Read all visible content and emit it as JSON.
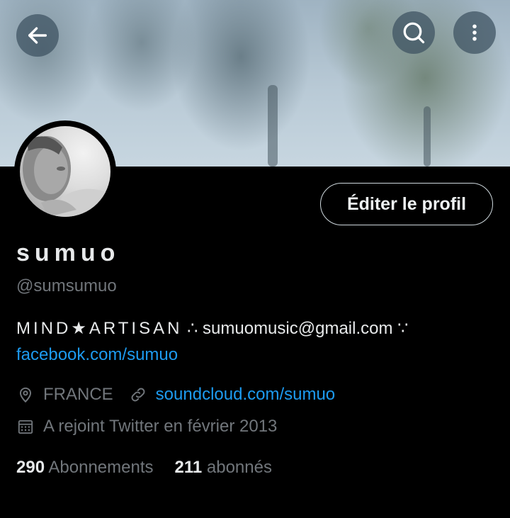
{
  "profile": {
    "display_name": "sumuo",
    "handle": "@sumsumuo",
    "bio_line1_caps": "MIND★ARTISAN",
    "bio_line1_rest": " ∴ sumuomusic@gmail.com ∵",
    "bio_link": "facebook.com/sumuo",
    "location": "FRANCE",
    "website": "soundcloud.com/sumuo",
    "joined": "A rejoint Twitter en février 2013",
    "following_count": "290",
    "following_label": "Abonnements",
    "followers_count": "211",
    "followers_label": "abonnés"
  },
  "actions": {
    "edit_profile_label": "Éditer le profil"
  },
  "icons": {
    "back": "arrow-left-icon",
    "search": "search-icon",
    "more": "more-vertical-icon",
    "location": "map-pin-icon",
    "website": "link-icon",
    "joined": "calendar-icon"
  },
  "colors": {
    "background": "#000000",
    "link": "#1d9bf0",
    "secondary_text": "#71767b",
    "primary_text": "#e7e9ea"
  }
}
